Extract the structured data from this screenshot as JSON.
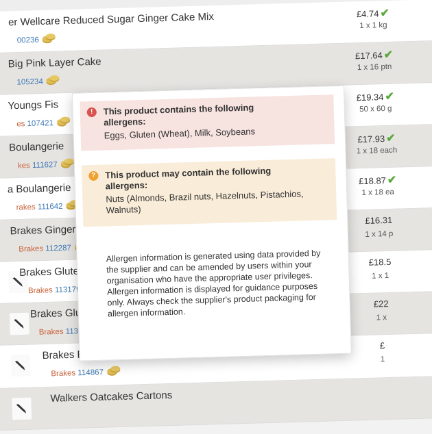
{
  "products": [
    {
      "name": "er Wellcare Reduced Sugar Ginger Cake Mix",
      "brand": "",
      "code": "00236",
      "price": "£4.74",
      "pack": "1 x 1 kg",
      "available": true,
      "thumb": false
    },
    {
      "name": "Big Pink Layer Cake",
      "brand": "",
      "code": "105234",
      "price": "£17.64",
      "pack": "1 x 16 ptn",
      "available": true,
      "thumb": false
    },
    {
      "name": "Youngs Fis",
      "brand": "es",
      "code": "107421",
      "price": "£19.34",
      "pack": "50 x 60 g",
      "available": true,
      "thumb": false
    },
    {
      "name": "Boulangerie",
      "brand": "kes",
      "code": "111627",
      "price": "£17.93",
      "pack": "1 x 18 each",
      "available": true,
      "thumb": false
    },
    {
      "name": "a Boulangerie",
      "brand": "rakes",
      "code": "111642",
      "price": "£18.87",
      "pack": "1 x 18 ea",
      "available": true,
      "thumb": false
    },
    {
      "name": "Brakes Gingerbr",
      "brand": "Brakes",
      "code": "112287",
      "price": "£16.31",
      "pack": "1 x 14 p",
      "available": false,
      "thumb": false
    },
    {
      "name": "Brakes Gluten F",
      "brand": "Brakes",
      "code": "113179",
      "price": "£18.5",
      "pack": "1 x 1",
      "available": false,
      "thumb": true
    },
    {
      "name": "Brakes Gluten F",
      "brand": "Brakes",
      "code": "113846",
      "price": "£22",
      "pack": "1 x",
      "available": false,
      "thumb": true
    },
    {
      "name": "Brakes Eton Mess Cheesecake",
      "brand": "Brakes",
      "code": "114867",
      "price": "£",
      "pack": "1",
      "available": false,
      "thumb": true
    },
    {
      "name": "Walkers Oatcakes Cartons",
      "brand": "",
      "code": "",
      "price": "",
      "pack": "",
      "available": false,
      "thumb": true
    }
  ],
  "allergen_popup": {
    "contains": {
      "heading": "This product contains the following allergens:",
      "list": "Eggs, Gluten (Wheat), Milk, Soybeans",
      "icon": "exclamation-icon",
      "color": "#d9534f"
    },
    "may_contain": {
      "heading": "This product may contain the following allergens:",
      "list": "Nuts (Almonds, Brazil nuts, Hazelnuts, Pistachios, Walnuts)",
      "icon": "question-icon",
      "color": "#f0a030"
    },
    "disclaimer": "Allergen information is generated using data provided by the supplier and can be amended by users within your organisation who have the appropriate user privileges. Allergen information is displayed for guidance purposes only. Always check the supplier's product packaging for allergen information."
  },
  "icons": {
    "price_status": "checkmark-icon",
    "allergen": "coin-stack-icon",
    "thumbnail": "pen-icon"
  },
  "colors": {
    "tick": "#5aa83c",
    "brand": "#c8623a",
    "code": "#3c78b4"
  }
}
